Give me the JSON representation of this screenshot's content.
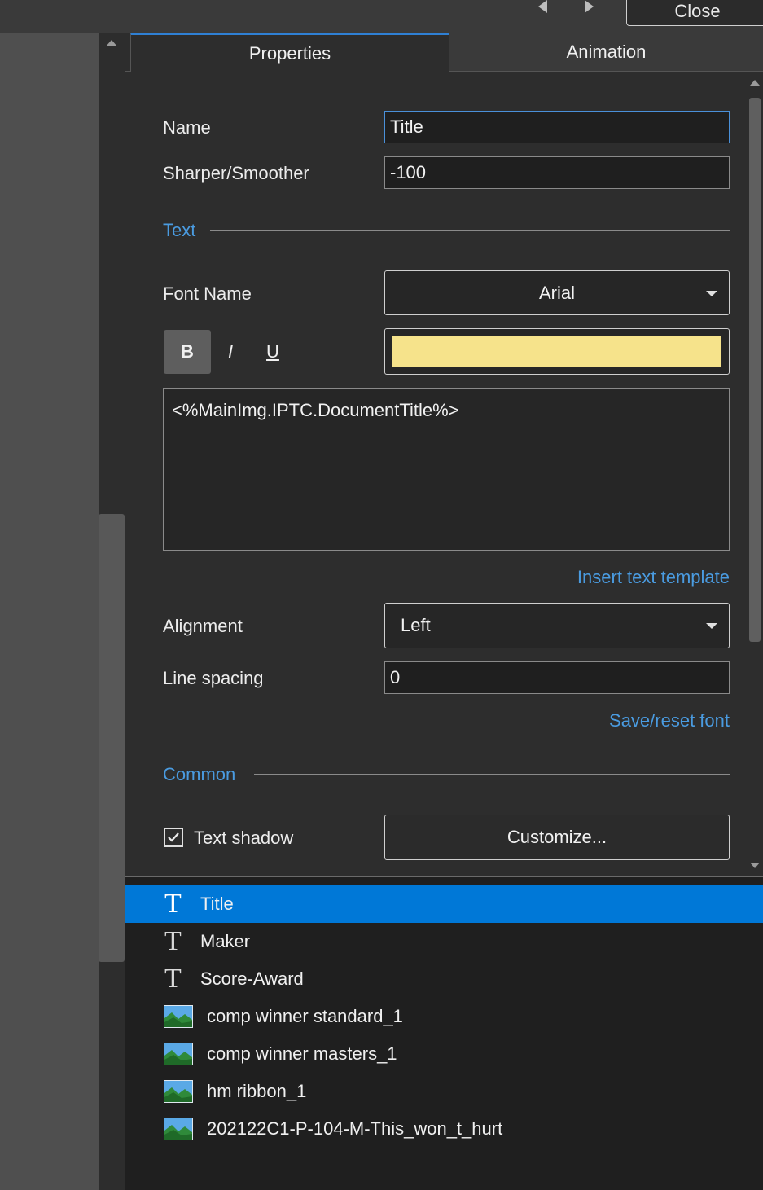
{
  "topbar": {
    "close_label": "Close"
  },
  "tabs": [
    {
      "label": "Properties"
    },
    {
      "label": "Animation"
    }
  ],
  "properties": {
    "name": {
      "label": "Name",
      "value": "Title"
    },
    "sharper": {
      "label": "Sharper/Smoother",
      "value": "-100"
    },
    "text_section": "Text",
    "font": {
      "label": "Font Name",
      "value": "Arial"
    },
    "style_buttons": {
      "bold": "B",
      "italic": "I",
      "underline": "U"
    },
    "text_color": "#f6e38b",
    "text_content": "<%MainImg.IPTC.DocumentTitle%>",
    "insert_template_label": "Insert text template",
    "alignment": {
      "label": "Alignment",
      "value": "Left"
    },
    "line_spacing": {
      "label": "Line spacing",
      "value": "0"
    },
    "save_reset_label": "Save/reset font",
    "common_section": "Common",
    "text_shadow": {
      "label": "Text shadow",
      "checked": true
    },
    "customize_label": "Customize..."
  },
  "objects": [
    {
      "type": "text",
      "icon": "text-icon",
      "label": "Title",
      "selected": true
    },
    {
      "type": "text",
      "icon": "text-icon",
      "label": "Maker",
      "selected": false
    },
    {
      "type": "text",
      "icon": "text-icon",
      "label": "Score-Award",
      "selected": false
    },
    {
      "type": "image",
      "icon": "image-icon",
      "label": "comp winner standard_1",
      "selected": false
    },
    {
      "type": "image",
      "icon": "image-icon",
      "label": "comp winner masters_1",
      "selected": false
    },
    {
      "type": "image",
      "icon": "image-icon",
      "label": "hm ribbon_1",
      "selected": false
    },
    {
      "type": "image",
      "icon": "image-icon",
      "label": "202122C1-P-104-M-This_won_t_hurt",
      "selected": false
    }
  ],
  "colors": {
    "accent": "#0078d7",
    "link": "#4a9be0",
    "tab_indicator": "#2f80d4"
  }
}
